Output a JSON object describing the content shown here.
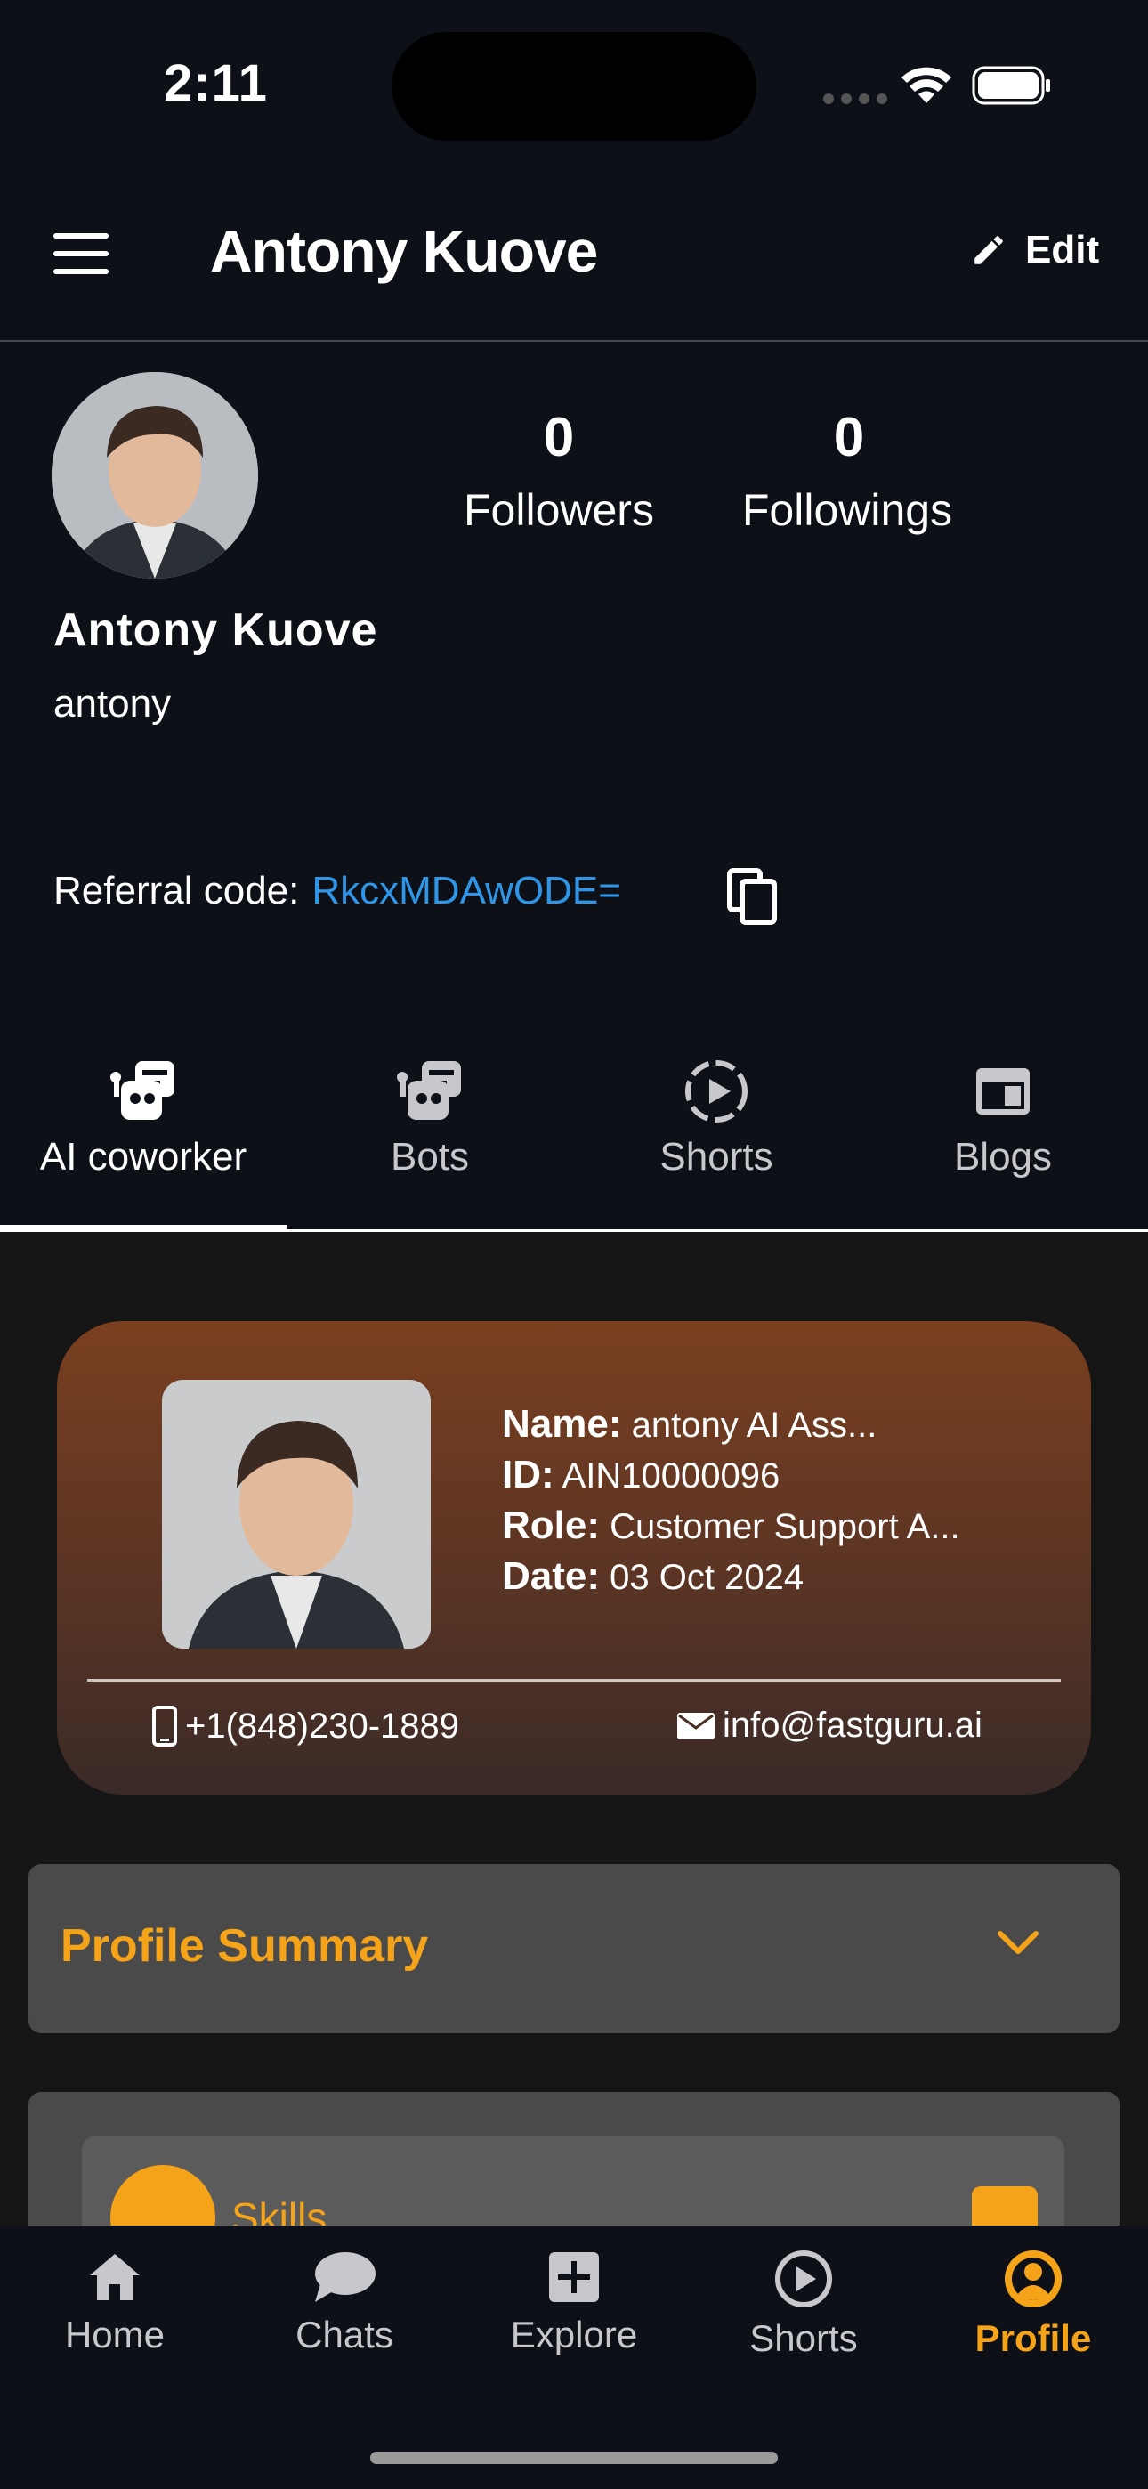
{
  "status_bar": {
    "time": "2:11"
  },
  "header": {
    "title": "Antony Kuove",
    "edit_label": "Edit"
  },
  "profile": {
    "followers_count": "0",
    "followers_label": "Followers",
    "followings_count": "0",
    "followings_label": "Followings",
    "name": "Antony Kuove",
    "username": "antony",
    "referral_label": "Referral code:",
    "referral_code": "RkcxMDAwODE="
  },
  "tabs": [
    {
      "label": "AI coworker",
      "icon": "bot-icon",
      "active": true
    },
    {
      "label": "Bots",
      "icon": "bot-icon",
      "active": false
    },
    {
      "label": "Shorts",
      "icon": "play-circle-icon",
      "active": false
    },
    {
      "label": "Blogs",
      "icon": "blog-icon",
      "active": false
    }
  ],
  "coworker_card": {
    "name_label": "Name:",
    "name_value": "antony AI Ass...",
    "id_label": "ID:",
    "id_value": "AIN10000096",
    "role_label": "Role:",
    "role_value": "Customer Support A...",
    "date_label": "Date:",
    "date_value": "03 Oct 2024",
    "phone": "+1(848)230-1889",
    "email": "info@fastguru.ai"
  },
  "profile_summary": {
    "title": "Profile Summary"
  },
  "skills": {
    "label": "Skills"
  },
  "bottom_nav": [
    {
      "label": "Home",
      "icon": "home-icon",
      "active": false
    },
    {
      "label": "Chats",
      "icon": "chat-bubble-icon",
      "active": false
    },
    {
      "label": "Explore",
      "icon": "plus-square-icon",
      "active": false
    },
    {
      "label": "Shorts",
      "icon": "play-circle-icon",
      "active": false
    },
    {
      "label": "Profile",
      "icon": "profile-icon",
      "active": true
    }
  ],
  "colors": {
    "accent": "#f5a318",
    "link": "#2f95e6",
    "background": "#0d1117"
  }
}
